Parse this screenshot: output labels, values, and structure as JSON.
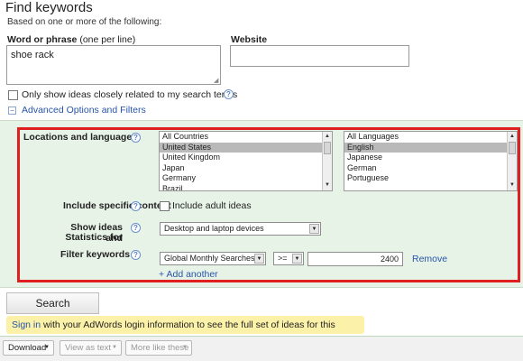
{
  "header": {
    "title": "Find keywords",
    "subtitle": "Based on one or more of the following:"
  },
  "word_phrase": {
    "label": "Word or phrase",
    "hint": "(one per line)",
    "value": "shoe rack"
  },
  "website": {
    "label": "Website",
    "value": ""
  },
  "closely_related": {
    "label": "Only show ideas closely related to my search terms",
    "checked": false
  },
  "advanced": {
    "toggle_symbol": "−",
    "link": "Advanced Options and Filters",
    "locations": {
      "label": "Locations and languages",
      "countries": [
        "All Countries",
        "United States",
        "United Kingdom",
        "Japan",
        "Germany",
        "Brazil"
      ],
      "countries_selected": "United States",
      "languages": [
        "All Languages",
        "English",
        "Japanese",
        "German",
        "Portuguese"
      ],
      "languages_selected": "English"
    },
    "specific_content": {
      "label": "Include specific content",
      "checkbox_label": "Include adult ideas",
      "checked": false
    },
    "show_ideas": {
      "label_line1": "Show ideas and",
      "label_line2": "Statistics for",
      "value": "Desktop and laptop devices"
    },
    "filter": {
      "label": "Filter keywords",
      "metric": "Global Monthly Searches",
      "operator": ">=",
      "value": "2400",
      "remove": "Remove",
      "add_another": "+ Add another"
    }
  },
  "search_button": "Search",
  "signin": {
    "link": "Sign in",
    "text": " with your AdWords login information to see the full set of ideas for this search."
  },
  "toolbar": {
    "download": "Download",
    "view_as_text": "View as text",
    "more_like_these": "More like these"
  },
  "colors": {
    "link": "#2754a8",
    "panel_bg": "#e8f3e8",
    "highlight_frame": "#e02020",
    "signin_bg": "#fbf1a9"
  },
  "icons": {
    "help": "question-mark-icon",
    "collapse": "minus-box-icon",
    "dropdown": "triangle-down-icon"
  }
}
